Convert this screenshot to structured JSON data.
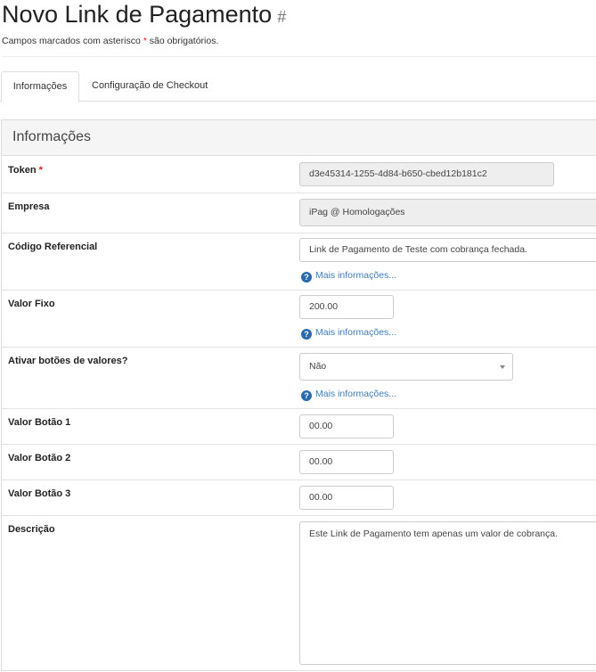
{
  "page": {
    "title": "Novo Link de Pagamento",
    "title_hash": "#",
    "required_note_before": "Campos marcados com asterisco ",
    "required_star": "*",
    "required_note_after": " são obrigatórios."
  },
  "tabs": [
    {
      "label": "Informações",
      "active": true
    },
    {
      "label": "Configuração de Checkout",
      "active": false
    }
  ],
  "panel": {
    "title": "Informações"
  },
  "fields": {
    "token": {
      "label": "Token",
      "required_star": "*",
      "value": "d3e45314-1255-4d84-b650-cbed12b181c2"
    },
    "empresa": {
      "label": "Empresa",
      "value": "iPag @ Homologações"
    },
    "codigo_referencial": {
      "label": "Código Referencial",
      "value": "Link de Pagamento de Teste com cobrança fechada.",
      "help": "Mais informações..."
    },
    "valor_fixo": {
      "label": "Valor Fixo",
      "value": "200.00",
      "help": "Mais informações..."
    },
    "ativar_botoes": {
      "label": "Ativar botões de valores?",
      "selected": "Não",
      "help": "Mais informações..."
    },
    "valor_botao_1": {
      "label": "Valor Botão 1",
      "value": "00.00"
    },
    "valor_botao_2": {
      "label": "Valor Botão 2",
      "value": "00.00"
    },
    "valor_botao_3": {
      "label": "Valor Botão 3",
      "value": "00.00"
    },
    "descricao": {
      "label": "Descrição",
      "value": "Este Link de Pagamento tem apenas um valor de cobrança."
    }
  },
  "icons": {
    "help": "question-circle-icon",
    "dropdown": "caret-down-icon"
  },
  "colors": {
    "required": "#e02020",
    "link": "#3c7dbd",
    "help_icon": "#2a6bad",
    "panel_heading": "#f5f5f5",
    "readonly_bg": "#eeeeee"
  }
}
